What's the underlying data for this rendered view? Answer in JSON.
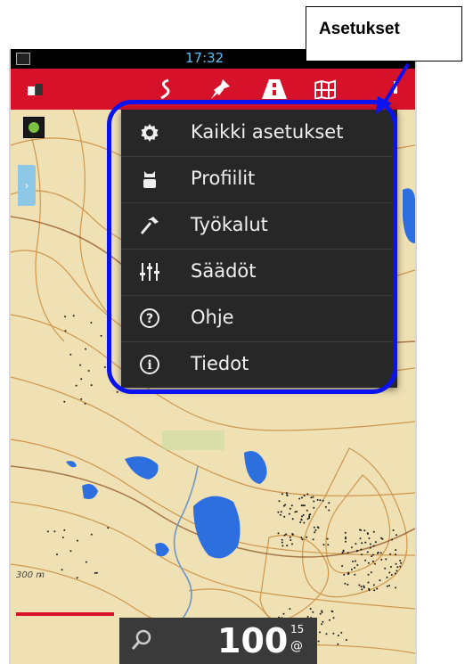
{
  "callout": {
    "label": "Asetukset"
  },
  "statusbar": {
    "time": "17:32"
  },
  "actionbar": {
    "icons": [
      "profile-small-icon",
      "route-icon",
      "pin-icon",
      "road-icon",
      "map-icon",
      "overflow-icon"
    ]
  },
  "menu": {
    "items": [
      {
        "label": "Kaikki asetukset",
        "icon": "gear-icon"
      },
      {
        "label": "Profiilit",
        "icon": "person-icon"
      },
      {
        "label": "Työkalut",
        "icon": "tools-icon"
      },
      {
        "label": "Säädöt",
        "icon": "sliders-icon"
      },
      {
        "label": "Ohje",
        "icon": "help-icon"
      },
      {
        "label": "Tiedot",
        "icon": "info-icon"
      }
    ]
  },
  "map": {
    "scale_label": "300 m"
  },
  "bottom_bar": {
    "value": "100",
    "sup": "15",
    "sub": "@"
  },
  "colors": {
    "actionbar": "#d7112a",
    "menu_background": "#272727",
    "highlight_border": "#0a12ee",
    "water": "#2e6fe0",
    "terrain": "#efe1b4"
  }
}
